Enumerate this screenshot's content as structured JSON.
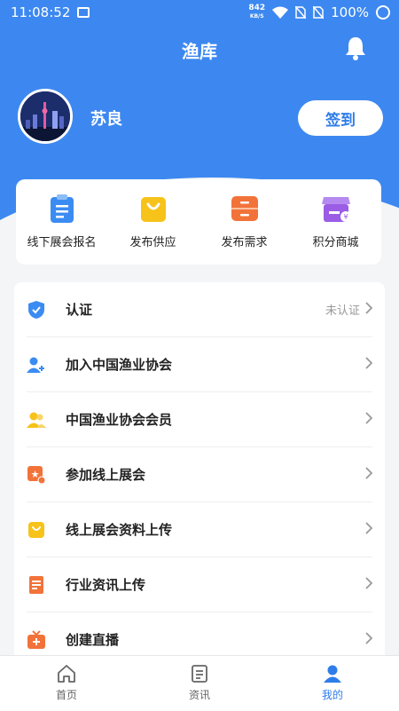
{
  "status_bar": {
    "time": "11:08:52",
    "speed_value": "842",
    "speed_unit": "KB/S",
    "battery": "100%"
  },
  "header": {
    "title": "渔库"
  },
  "profile": {
    "name": "苏良",
    "signin_label": "签到"
  },
  "quick_actions": [
    {
      "label": "线下展会报名",
      "icon": "clipboard-icon",
      "color": "#3b8cf2"
    },
    {
      "label": "发布供应",
      "icon": "shopping-bag-icon",
      "color": "#f7c21a"
    },
    {
      "label": "发布需求",
      "icon": "drawer-icon",
      "color": "#f2733a"
    },
    {
      "label": "积分商城",
      "icon": "store-icon",
      "color": "#9b5de5"
    }
  ],
  "menu": [
    {
      "label": "认证",
      "status": "未认证",
      "icon": "shield-check-icon",
      "color": "#3b8cf2"
    },
    {
      "label": "加入中国渔业协会",
      "icon": "user-add-icon",
      "color": "#3b8cf2"
    },
    {
      "label": "中国渔业协会会员",
      "icon": "users-icon",
      "color": "#f7c21a"
    },
    {
      "label": "参加线上展会",
      "icon": "star-badge-icon",
      "color": "#f2733a"
    },
    {
      "label": "线上展会资料上传",
      "icon": "bag-icon",
      "color": "#f7c21a"
    },
    {
      "label": "行业资讯上传",
      "icon": "document-icon",
      "color": "#f2733a"
    },
    {
      "label": "创建直播",
      "icon": "tv-add-icon",
      "color": "#f2733a"
    }
  ],
  "tabs": [
    {
      "label": "首页",
      "icon": "home-icon",
      "active": false
    },
    {
      "label": "资讯",
      "icon": "news-icon",
      "active": false
    },
    {
      "label": "我的",
      "icon": "user-icon",
      "active": true
    }
  ],
  "colors": {
    "primary": "#3d88f0",
    "active_tab": "#2f7de8"
  }
}
